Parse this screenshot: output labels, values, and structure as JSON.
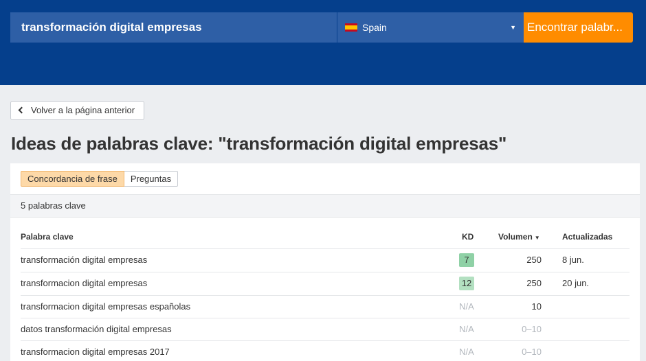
{
  "search": {
    "query": "transformación digital empresas",
    "country": "Spain",
    "find_button": "Encontrar palabr..."
  },
  "back_button": "Volver a la página anterior",
  "page_title": "Ideas de palabras clave: \"transformación digital empresas\"",
  "tabs": [
    {
      "label": "Concordancia de frase",
      "active": true
    },
    {
      "label": "Preguntas",
      "active": false
    }
  ],
  "keyword_count": "5 palabras clave",
  "columns": {
    "keyword": "Palabra clave",
    "kd": "KD",
    "volume": "Volumen",
    "updated": "Actualizadas"
  },
  "rows": [
    {
      "keyword": "transformación digital empresas",
      "kd": "7",
      "volume": "250",
      "updated": "8 jun."
    },
    {
      "keyword": "transformacion digital empresas",
      "kd": "12",
      "volume": "250",
      "updated": "20 jun."
    },
    {
      "keyword": "transformacion digital empresas españolas",
      "kd": "N/A",
      "volume": "10",
      "updated": ""
    },
    {
      "keyword": "datos transformación digital empresas",
      "kd": "N/A",
      "volume": "0–10",
      "updated": ""
    },
    {
      "keyword": "transformacion digital empresas 2017",
      "kd": "N/A",
      "volume": "0–10",
      "updated": ""
    }
  ],
  "colors": {
    "header_bg": "#053f8c",
    "input_bg": "#2e5fa6",
    "accent_orange": "#ff8c00",
    "kd_easy_1": "#8fd1a6",
    "kd_easy_2": "#b3e0c1"
  }
}
